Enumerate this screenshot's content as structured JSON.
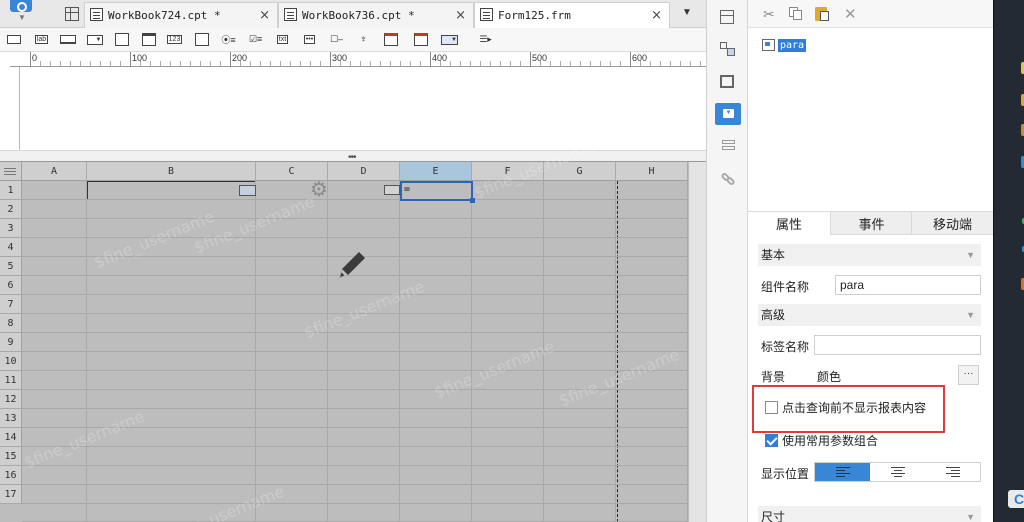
{
  "tabs": [
    {
      "label": "WorkBook724.cpt *",
      "close": "×"
    },
    {
      "label": "WorkBook736.cpt *",
      "close": "×"
    },
    {
      "label": "Form125.frm",
      "close": "×"
    }
  ],
  "tab_menu_icon": "▼",
  "widget_toolbar": {
    "items": [
      "text-widget-icon",
      "label-widget-icon",
      "button-widget-icon",
      "combo-widget-icon",
      "date-widget-icon",
      "calendar-widget-icon",
      "number-widget-icon",
      "textarea-widget-icon",
      "radio-group-icon",
      "checkbox-group-icon",
      "text-area-icon",
      "password-icon",
      "checkbox-icon",
      "tree-widget-icon",
      "date-range-icon",
      "date-range-icon-2",
      "dropdown-tree-icon",
      "more-widgets-icon"
    ],
    "labels": {
      "label_widget": "lab",
      "number_widget": "123",
      "textarea_widget": "txt"
    }
  },
  "ruler": {
    "marks": [
      "0",
      "100",
      "200",
      "300",
      "400",
      "500",
      "600"
    ]
  },
  "sheet": {
    "columns": [
      "A",
      "B",
      "C",
      "D",
      "E",
      "F",
      "G",
      "H"
    ],
    "rows": [
      "1",
      "2",
      "3",
      "4",
      "5",
      "6",
      "7",
      "8",
      "9",
      "10",
      "11",
      "12",
      "13",
      "14",
      "15",
      "16",
      "17"
    ],
    "selected_column": "E",
    "e1_value": "=",
    "watermark": "$fine_username"
  },
  "property_panel": {
    "tree_item": "para",
    "tabs": [
      "属性",
      "事件",
      "移动端"
    ],
    "active_tab": "属性",
    "section_basic": "基本",
    "widget_name_label": "组件名称",
    "widget_name_value": "para",
    "section_advanced": "高级",
    "tag_name_label": "标签名称",
    "tag_name_value": "",
    "background_label": "背景",
    "background_value": "颜色",
    "more_button": "···",
    "checkbox_no_display_label": "点击查询前不显示报表内容",
    "checkbox_no_display_checked": false,
    "checkbox_common_params_label": "使用常用参数组合",
    "checkbox_common_params_checked": true,
    "display_position_label": "显示位置",
    "section_size": "尺寸"
  },
  "colors": {
    "accent": "#3a86d6",
    "highlight_box": "#e03b3b",
    "sheet_bg": "#bdbdbd"
  }
}
